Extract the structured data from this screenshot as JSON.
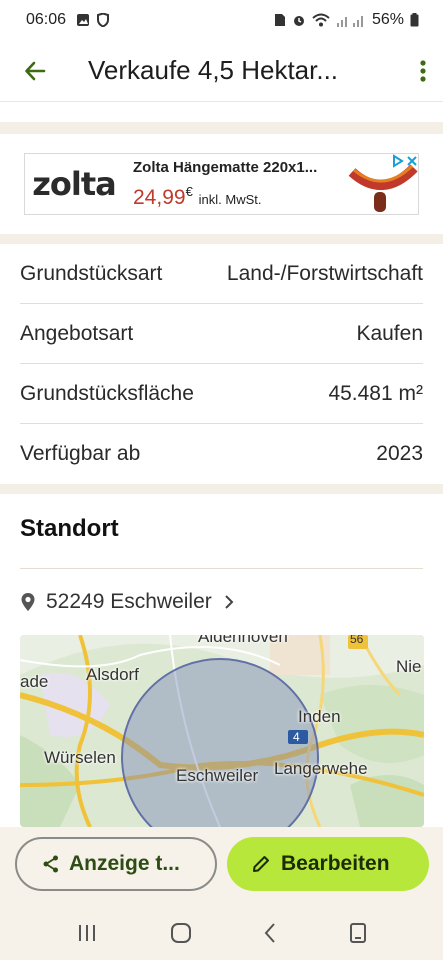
{
  "status_bar": {
    "time": "06:06",
    "battery": "56%",
    "icons": [
      "image-icon",
      "shield-icon",
      "sim-icon",
      "alarm-icon",
      "wifi-icon",
      "signal-icon",
      "battery-icon"
    ]
  },
  "app_bar": {
    "title": "Verkaufe 4,5 Hektar...",
    "back_icon": "arrow-back-icon",
    "menu_icon": "more-vert-icon"
  },
  "ad": {
    "brand": "zolta",
    "product": "Zolta Hängematte 220x1...",
    "price": "24,99",
    "currency": "€",
    "tax_note": "inkl. MwSt.",
    "colors": {
      "price": "#c0392b",
      "brand_accent": "#f3b414"
    }
  },
  "details": [
    {
      "label": "Grundstücksart",
      "value": "Land-/Forstwirtschaft"
    },
    {
      "label": "Angebotsart",
      "value": "Kaufen"
    },
    {
      "label": "Grundstücksfläche",
      "value": "45.481 m²"
    },
    {
      "label": "Verfügbar ab",
      "value": "2023"
    }
  ],
  "standort": {
    "title": "Standort",
    "location": "52249 Eschweiler"
  },
  "map": {
    "labels": [
      "Aldenhoven",
      "56",
      "Nie",
      "Alsdorf",
      "ade",
      "Inden",
      "4",
      "Würselen",
      "Eschweiler",
      "Langerwehe"
    ]
  },
  "actions": {
    "share_label": "Anzeige t...",
    "edit_label": "Bearbeiten",
    "colors": {
      "edit_bg": "#b6e73a",
      "share_text": "#2e4d14"
    }
  },
  "nav": {
    "icons": [
      "recent-apps-icon",
      "home-icon",
      "back-icon",
      "keyboard-icon"
    ]
  }
}
